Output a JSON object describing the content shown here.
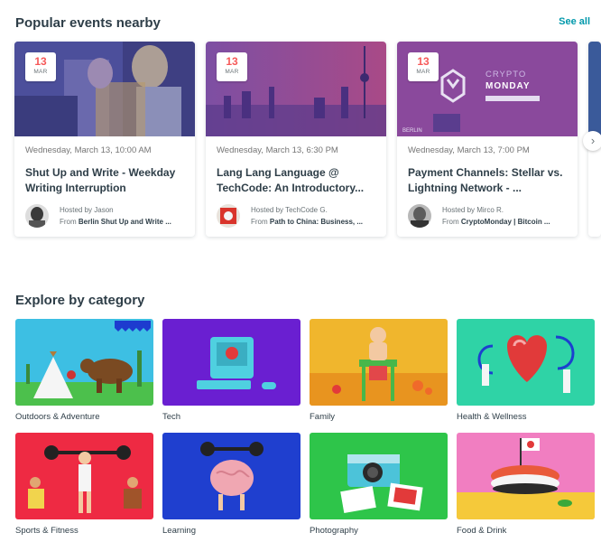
{
  "popular": {
    "heading": "Popular events nearby",
    "see_all": "See all",
    "events": [
      {
        "day": "13",
        "month": "MAR",
        "when": "Wednesday, March 13, 10:00 AM",
        "title": "Shut Up and Write - Weekday Writing Interruption",
        "hosted_by": "Hosted by Jason",
        "from_prefix": "From",
        "group": "Berlin Shut Up and Write ...",
        "tint": "#4c4e9a"
      },
      {
        "day": "13",
        "month": "MAR",
        "when": "Wednesday, March 13, 6:30 PM",
        "title": "Lang Lang Language @ TechCode: An Introductory...",
        "hosted_by": "Hosted by TechCode G.",
        "from_prefix": "From",
        "group": "Path to China: Business, ...",
        "tint": "#6e4ca6"
      },
      {
        "day": "13",
        "month": "MAR",
        "when": "Wednesday, March 13, 7:00 PM",
        "title": "Payment Channels: Stellar vs. Lightning Network - ...",
        "hosted_by": "Hosted by Mirco R.",
        "from_prefix": "From",
        "group": "CryptoMonday | Bitcoin ...",
        "tint": "#6a3f9e",
        "poster_line1": "CRYPTO",
        "poster_line2": "MONDAY",
        "poster_city": "BERLIN"
      }
    ]
  },
  "explore": {
    "heading": "Explore by category",
    "categories": [
      {
        "label": "Outdoors & Adventure",
        "bg": "#3fbde0"
      },
      {
        "label": "Tech",
        "bg": "#6a1fd1"
      },
      {
        "label": "Family",
        "bg": "#f0a823"
      },
      {
        "label": "Health & Wellness",
        "bg": "#2fd3a6"
      },
      {
        "label": "Sports & Fitness",
        "bg": "#ee2a43"
      },
      {
        "label": "Learning",
        "bg": "#1f3fcf"
      },
      {
        "label": "Photography",
        "bg": "#2ec54a"
      },
      {
        "label": "Food & Drink",
        "bg": "#f17ec1"
      }
    ]
  },
  "colors": {
    "accent": "#0098ab",
    "date": "#f65858",
    "text": "#2e3e48"
  }
}
